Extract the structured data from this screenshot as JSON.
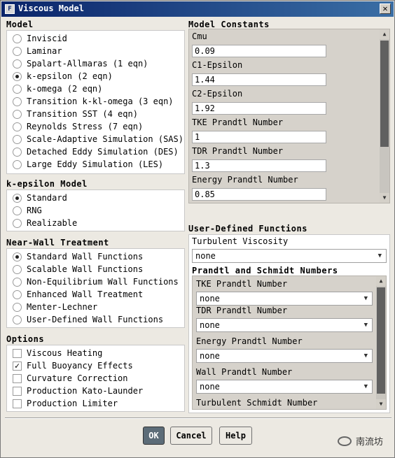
{
  "window": {
    "title": "Viscous Model",
    "app_icon": "F",
    "close": "✕"
  },
  "model": {
    "title": "Model",
    "options": [
      {
        "label": "Inviscid",
        "selected": false
      },
      {
        "label": "Laminar",
        "selected": false
      },
      {
        "label": "Spalart-Allmaras (1 eqn)",
        "selected": false
      },
      {
        "label": "k-epsilon (2 eqn)",
        "selected": true
      },
      {
        "label": "k-omega (2 eqn)",
        "selected": false
      },
      {
        "label": "Transition k-kl-omega (3 eqn)",
        "selected": false
      },
      {
        "label": "Transition SST (4 eqn)",
        "selected": false
      },
      {
        "label": "Reynolds Stress (7 eqn)",
        "selected": false
      },
      {
        "label": "Scale-Adaptive Simulation (SAS)",
        "selected": false
      },
      {
        "label": "Detached Eddy Simulation (DES)",
        "selected": false
      },
      {
        "label": "Large Eddy Simulation (LES)",
        "selected": false
      }
    ]
  },
  "ke_model": {
    "title": "k-epsilon Model",
    "options": [
      {
        "label": "Standard",
        "selected": true
      },
      {
        "label": "RNG",
        "selected": false
      },
      {
        "label": "Realizable",
        "selected": false
      }
    ]
  },
  "wall": {
    "title": "Near-Wall Treatment",
    "options": [
      {
        "label": "Standard Wall Functions",
        "selected": true
      },
      {
        "label": "Scalable Wall Functions",
        "selected": false
      },
      {
        "label": "Non-Equilibrium Wall Functions",
        "selected": false
      },
      {
        "label": "Enhanced Wall Treatment",
        "selected": false
      },
      {
        "label": "Menter-Lechner",
        "selected": false
      },
      {
        "label": "User-Defined Wall Functions",
        "selected": false
      }
    ]
  },
  "options": {
    "title": "Options",
    "items": [
      {
        "label": "Viscous Heating",
        "checked": false
      },
      {
        "label": "Full Buoyancy Effects",
        "checked": true
      },
      {
        "label": "Curvature Correction",
        "checked": false
      },
      {
        "label": "Production Kato-Launder",
        "checked": false
      },
      {
        "label": "Production Limiter",
        "checked": false
      }
    ]
  },
  "constants": {
    "title": "Model Constants",
    "items": [
      {
        "label": "Cmu",
        "value": "0.09"
      },
      {
        "label": "C1-Epsilon",
        "value": "1.44"
      },
      {
        "label": "C2-Epsilon",
        "value": "1.92"
      },
      {
        "label": "TKE Prandtl Number",
        "value": "1"
      },
      {
        "label": "TDR Prandtl Number",
        "value": "1.3"
      },
      {
        "label": "Energy Prandtl Number",
        "value": "0.85"
      }
    ]
  },
  "udf": {
    "title": "User-Defined Functions",
    "turbulent_viscosity_label": "Turbulent Viscosity",
    "turbulent_viscosity_value": "none",
    "prandtl_title": "Prandtl and Schmidt Numbers",
    "prandtl_items": [
      {
        "label": "TKE Prandtl Number",
        "value": "none"
      },
      {
        "label": "TDR Prandtl Number",
        "value": "none"
      },
      {
        "label": "Energy Prandtl Number",
        "value": "none"
      },
      {
        "label": "Wall Prandtl Number",
        "value": "none"
      },
      {
        "label": "Turbulent Schmidt Number",
        "value": ""
      }
    ]
  },
  "buttons": {
    "ok": "OK",
    "cancel": "Cancel",
    "help": "Help"
  },
  "watermark": "南流坊"
}
